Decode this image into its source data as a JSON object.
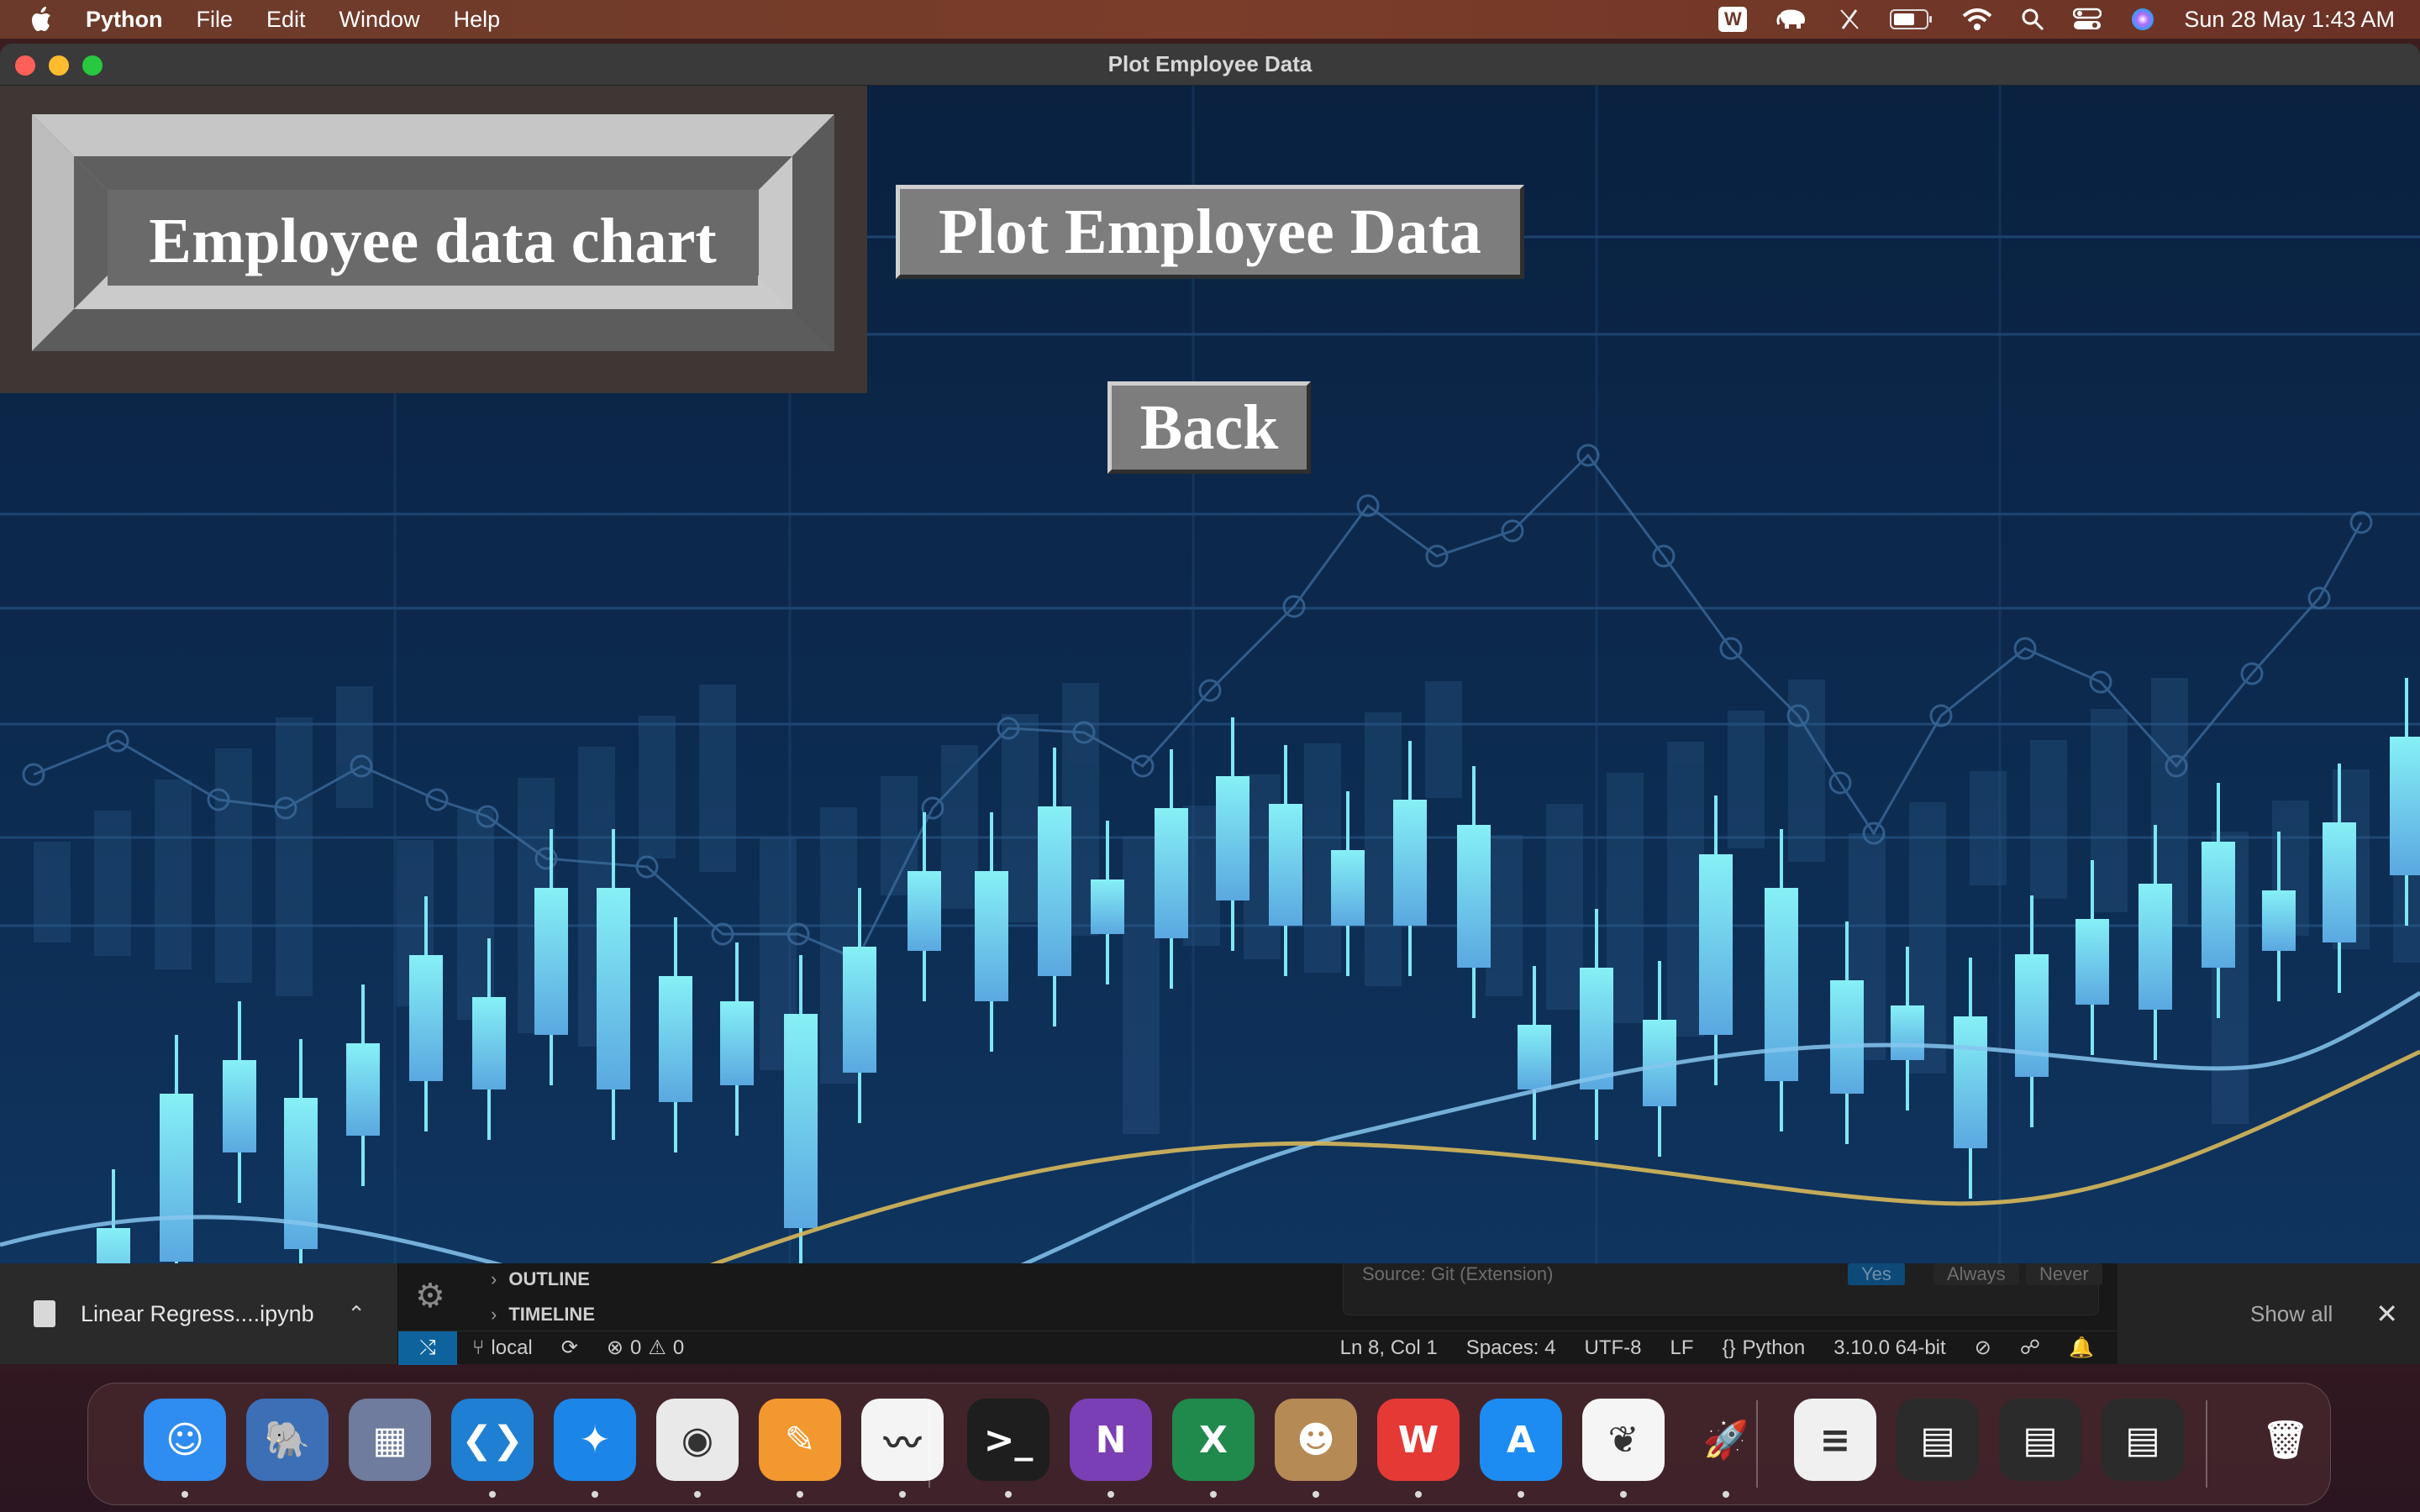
{
  "menubar": {
    "app_name": "Python",
    "menus": [
      "File",
      "Edit",
      "Window",
      "Help"
    ],
    "status_icons": [
      "wps-icon",
      "elephant-icon",
      "pen-slash-icon",
      "battery-icon",
      "wifi-icon",
      "search-icon",
      "control-center-icon",
      "siri-icon"
    ],
    "wps_label": "W",
    "datetime": "Sun 28 May  1:43 AM"
  },
  "window": {
    "title": "Plot Employee Data",
    "frame_label": "Employee data chart",
    "plot_button": "Plot Employee Data",
    "back_button": "Back"
  },
  "downloads": {
    "file_name": "Linear Regress....ipynb",
    "show_all": "Show all"
  },
  "vscode": {
    "outline": "OUTLINE",
    "timeline": "TIMELINE",
    "dialog_source": "Source: Git (Extension)",
    "dialog_options": [
      "Yes",
      "Always",
      "Never"
    ],
    "status": {
      "branch": "local",
      "errors": "0",
      "warnings": "0",
      "position": "Ln 8, Col 1",
      "spaces": "Spaces: 4",
      "encoding": "UTF-8",
      "eol": "LF",
      "language": "Python",
      "interpreter": "3.10.0 64-bit"
    }
  },
  "dock": {
    "apps": [
      {
        "name": "Finder",
        "icon": "finder-icon",
        "glyph": "☺",
        "color": "#2f8cf0",
        "running": true
      },
      {
        "name": "TablePlus",
        "icon": "elephant-icon",
        "glyph": "🐘",
        "color": "#3d6fb6",
        "running": false
      },
      {
        "name": "Launchpad",
        "icon": "launchpad-icon",
        "glyph": "▦",
        "color": "#6f7c9e",
        "running": false
      },
      {
        "name": "Visual Studio Code",
        "icon": "vscode-icon",
        "glyph": "❮❯",
        "color": "#1f7fd3",
        "running": true
      },
      {
        "name": "Safari",
        "icon": "safari-icon",
        "glyph": "✦",
        "color": "#1b86e8",
        "running": true
      },
      {
        "name": "Google Chrome",
        "icon": "chrome-icon",
        "glyph": "◉",
        "color": "#e9e9e9",
        "running": true
      },
      {
        "name": "Pages",
        "icon": "pages-icon",
        "glyph": "✎",
        "color": "#f2982e",
        "running": true
      },
      {
        "name": "Freeform",
        "icon": "freeform-icon",
        "glyph": "〰",
        "color": "#f4f4f4",
        "running": true
      },
      {
        "name": "Terminal",
        "icon": "terminal-icon",
        "glyph": ">_",
        "color": "#1e1e1e",
        "running": true
      },
      {
        "name": "OneNote",
        "icon": "onenote-icon",
        "glyph": "N",
        "color": "#7b3fb5",
        "running": true
      },
      {
        "name": "Excel",
        "icon": "excel-icon",
        "glyph": "X",
        "color": "#1f8a4c",
        "running": true
      },
      {
        "name": "Contacts",
        "icon": "contacts-icon",
        "glyph": "☻",
        "color": "#b58a55",
        "running": true
      },
      {
        "name": "WPS Office",
        "icon": "wps-icon",
        "glyph": "W",
        "color": "#e53935",
        "running": true
      },
      {
        "name": "App Store",
        "icon": "app-store-icon",
        "glyph": "A",
        "color": "#1c8cf2",
        "running": true
      },
      {
        "name": "MongoDB Compass",
        "icon": "mongodb-icon",
        "glyph": "❦",
        "color": "#f5f5f5",
        "running": true
      },
      {
        "name": "Python Launcher",
        "icon": "python-rocket-icon",
        "glyph": "🚀",
        "color": "transparent",
        "running": true
      },
      {
        "name": "Document",
        "icon": "document-icon",
        "glyph": "≡",
        "color": "#f0f0f0",
        "running": false
      },
      {
        "name": "Window Preview 1",
        "icon": "window-preview-icon",
        "glyph": "▤",
        "color": "#2b2b2b",
        "running": false
      },
      {
        "name": "Window Preview 2",
        "icon": "window-preview-icon",
        "glyph": "▤",
        "color": "#2b2b2b",
        "running": false
      },
      {
        "name": "Window Preview 3",
        "icon": "window-preview-icon",
        "glyph": "▤",
        "color": "#2b2b2b",
        "running": false
      },
      {
        "name": "Trash",
        "icon": "trash-icon",
        "glyph": "🗑",
        "color": "transparent",
        "running": false
      }
    ]
  },
  "colors": {
    "canvas_bg": "#0b2240",
    "candle": "#7fe6f2",
    "yellow_curve": "#d8b85a",
    "blue_curve": "#7fbde8"
  }
}
